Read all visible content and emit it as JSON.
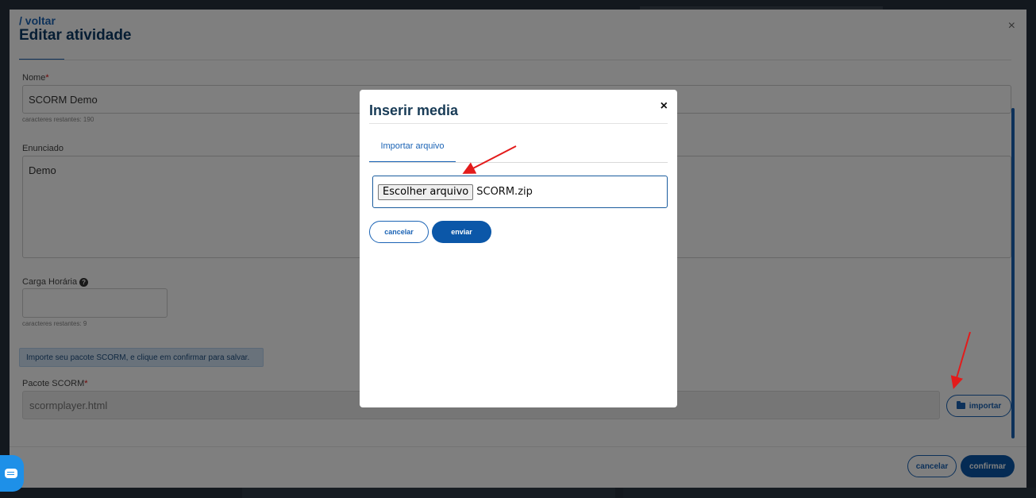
{
  "editor": {
    "back_label": "/ voltar",
    "title": "Editar atividade",
    "close_label": "×",
    "nome_label": "Nome",
    "required_mark": "*",
    "nome_value": "SCORM Demo",
    "nome_hint": "caracteres restantes: 190",
    "enunciado_label": "Enunciado",
    "enunciado_value": "Demo",
    "carga_label": "Carga Horária",
    "carga_value": "",
    "carga_hint": "caracteres restantes: 9",
    "info_banner": "Importe seu pacote SCORM, e clique em confirmar para salvar.",
    "scorm_label": "Pacote SCORM",
    "scorm_value": "scormplayer.html",
    "import_label": "importar",
    "cancel_label": "cancelar",
    "confirm_label": "confirmar"
  },
  "modal": {
    "title": "Inserir media",
    "close_label": "×",
    "tab_label": "Importar arquivo",
    "choose_label": "Escolher arquivo",
    "file_name": "SCORM.zip",
    "cancel_label": "cancelar",
    "send_label": "enviar"
  },
  "icons": {
    "help": "question-circle-icon",
    "folder": "folder-open-icon",
    "chat": "chat-bubble-icon"
  },
  "colors": {
    "accent": "#1a63b5",
    "primary_button": "#0b57a8",
    "title": "#183b56",
    "annotation_arrow": "#e31b1b"
  }
}
